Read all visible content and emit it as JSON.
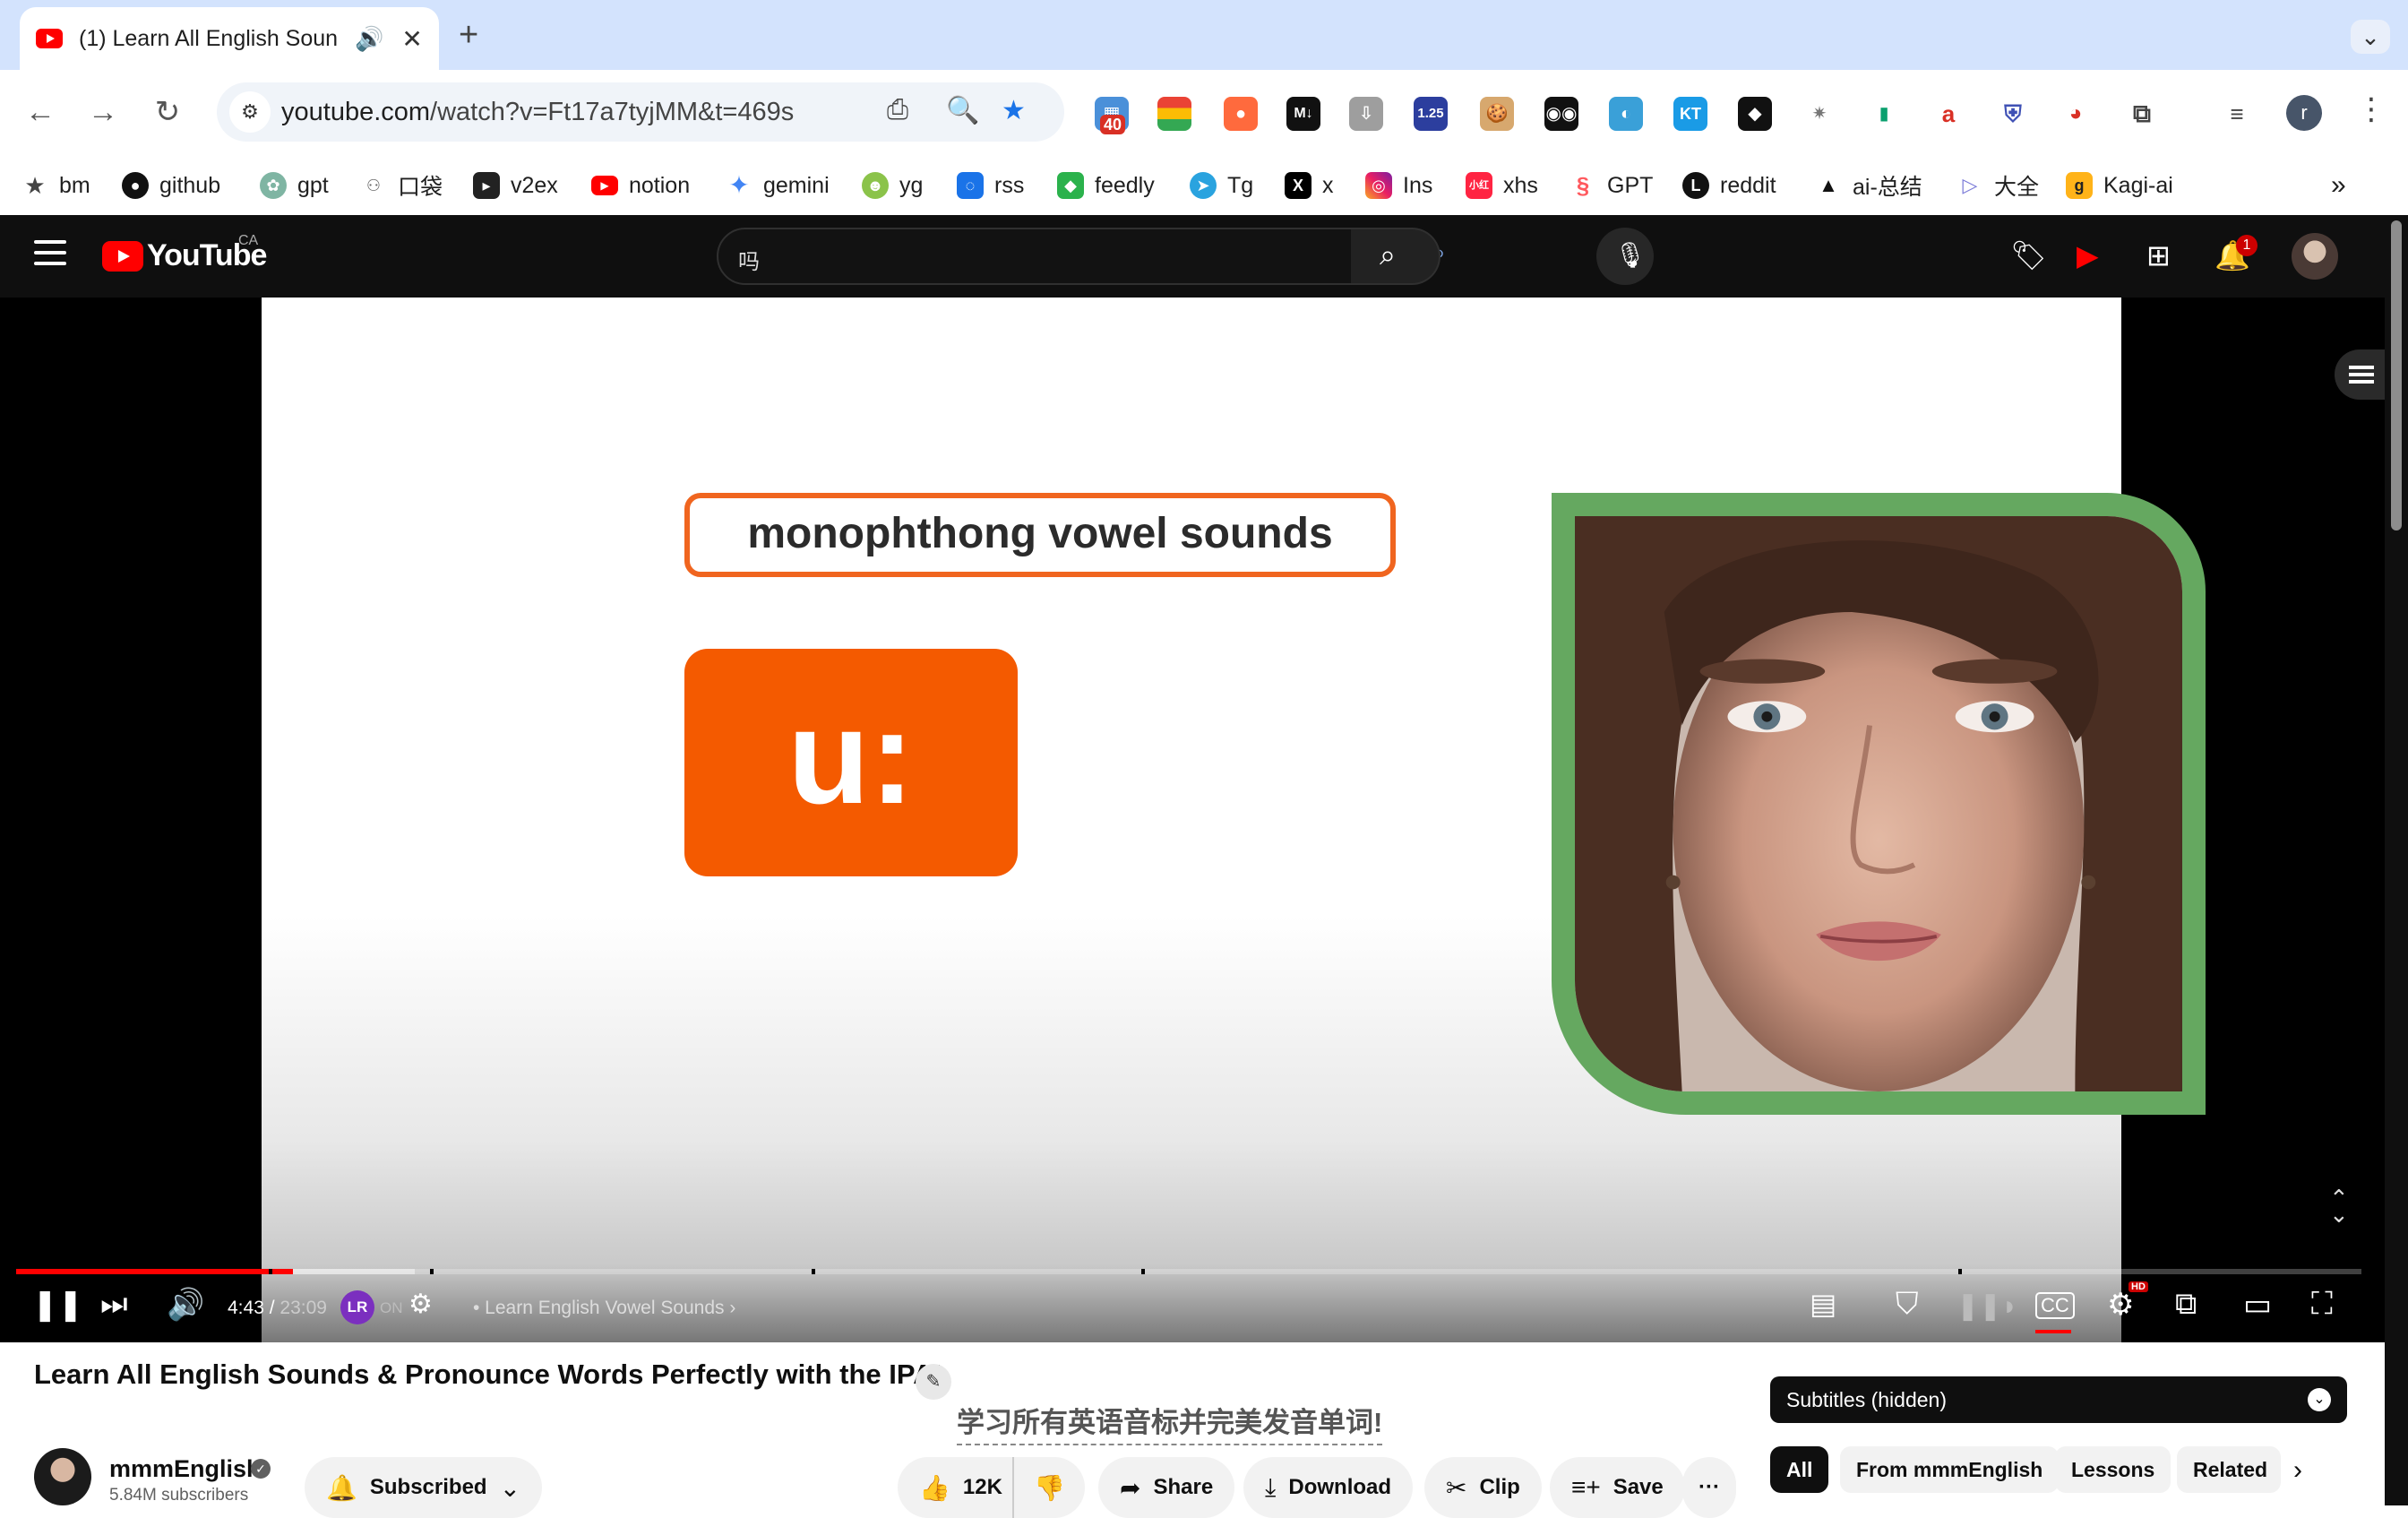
{
  "browser": {
    "tab": {
      "title": "(1) Learn All English Soun",
      "close": "✕"
    },
    "new_tab": "+",
    "omnibox": {
      "host": "youtube.com",
      "path": "/watch?v=Ft17a7tyjMM&t=469s"
    },
    "extensions": {
      "badge_count": "40",
      "speed": "1.25",
      "profile_initial": "r"
    },
    "bookmarks": [
      {
        "label": "bm",
        "icon": "star-icon"
      },
      {
        "label": "github",
        "icon": "github-icon"
      },
      {
        "label": "gpt",
        "icon": "openai-icon"
      },
      {
        "label": "口袋",
        "icon": "pocket-icon"
      },
      {
        "label": "v2ex",
        "icon": "v2ex-icon"
      },
      {
        "label": "notion",
        "icon": "youtube-icon"
      },
      {
        "label": "gemini",
        "icon": "sparkle-icon"
      },
      {
        "label": "yg",
        "icon": "yg-icon"
      },
      {
        "label": "rss",
        "icon": "rss-icon"
      },
      {
        "label": "feedly",
        "icon": "feedly-icon"
      },
      {
        "label": "Tg",
        "icon": "telegram-icon"
      },
      {
        "label": "x",
        "icon": "x-icon"
      },
      {
        "label": "Ins",
        "icon": "instagram-icon"
      },
      {
        "label": "xhs",
        "icon": "xhs-icon"
      },
      {
        "label": "GPT",
        "icon": "gpt-icon"
      },
      {
        "label": "reddit",
        "icon": "reddit-icon"
      },
      {
        "label": "ai-总结",
        "icon": "triangle-icon"
      },
      {
        "label": "大全",
        "icon": "play-outline-icon"
      },
      {
        "label": "Kagi-ai",
        "icon": "kagi-icon"
      }
    ],
    "more_bookmarks": "»"
  },
  "youtube": {
    "logo_text": "YouTube",
    "region": "CA",
    "search": {
      "ime_char": "吗"
    },
    "notifications_count": "1",
    "video": {
      "slide_heading": "monophthong vowel sounds",
      "slide_ipa": "u:",
      "current_time": "4:43",
      "duration": "23:09",
      "lr_status": "ON",
      "chapter": "• Learn English Vowel Sounds",
      "progress_fraction": 0.118,
      "buffered_fraction": 0.17
    },
    "title": "Learn All English Sounds & Pronounce Words Perfectly with the IPA!",
    "title_translation": "学习所有英语音标并完美发音单词!",
    "channel": {
      "name": "mmmEnglish",
      "subscribers": "5.84M subscribers"
    },
    "actions": {
      "subscribed": "Subscribed",
      "likes": "12K",
      "share": "Share",
      "download": "Download",
      "clip": "Clip",
      "save": "Save",
      "more": "···"
    },
    "subtitles_label": "Subtitles (hidden)",
    "chips": [
      "All",
      "From mmmEnglish",
      "Lessons",
      "Related"
    ],
    "colors": {
      "brand_red": "#ff0000",
      "slide_orange": "#f45a00",
      "frame_green": "#65a860"
    }
  }
}
